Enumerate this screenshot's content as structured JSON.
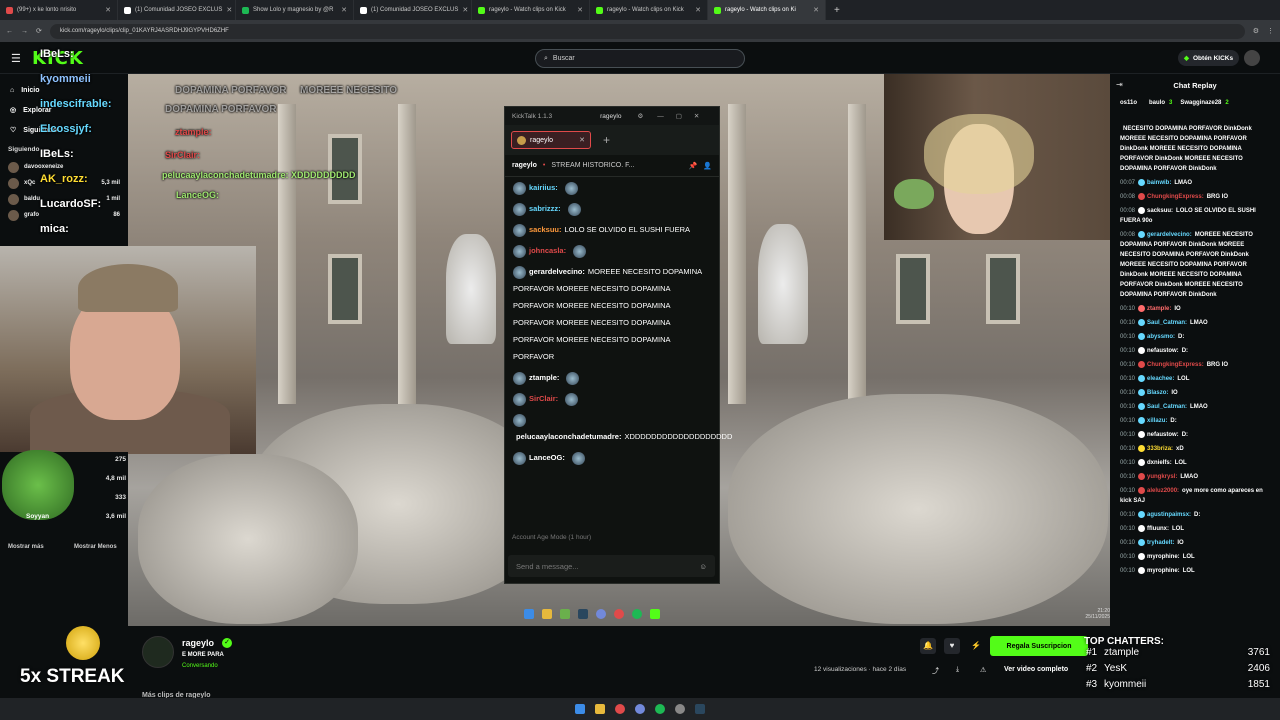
{
  "browser": {
    "tabs": [
      {
        "label": "(99+) x ke lonto nrisito",
        "active": false,
        "color": "#e04a4a"
      },
      {
        "label": "(1) Comunidad JOSEO EXCLUS",
        "active": false,
        "color": "#ffffff"
      },
      {
        "label": "Show Lolo y magnesio by @R",
        "active": false,
        "color": "#1db954"
      },
      {
        "label": "(1) Comunidad JOSEO EXCLUS",
        "active": false,
        "color": "#ffffff"
      },
      {
        "label": "rageylo - Watch clips on Kick",
        "active": false,
        "color": "#53fc18"
      },
      {
        "label": "rageylo - Watch clips on Kick",
        "active": false,
        "color": "#53fc18"
      },
      {
        "label": "rageylo - Watch clips on Ki",
        "active": true,
        "color": "#53fc18"
      }
    ],
    "url": "kick.com/rageylo/clips/clip_01KAYRJ4ASRDHJ9GYPVHD6ZHF"
  },
  "kick": {
    "logo": "KICK",
    "search_placeholder": "Buscar",
    "get_kicks": "Obtén KICKs",
    "nav": [
      "Inicio",
      "Explorar",
      "Siguiendo"
    ],
    "following_header": "Siguiendo",
    "following": [
      {
        "name": "davooxeneize",
        "count": ""
      },
      {
        "name": "xQc",
        "count": "5,3 mil"
      },
      {
        "name": "baldu",
        "count": "1 mil"
      },
      {
        "name": "grafo",
        "count": "86"
      },
      {
        "name": "",
        "count": "275"
      },
      {
        "name": "",
        "count": "4,8 mil"
      },
      {
        "name": "",
        "count": "333"
      },
      {
        "name": "Soyyan",
        "count": "3,6 mil"
      }
    ],
    "show_more": "Mostrar más",
    "show_less": "Mostrar Menos"
  },
  "overlay_chat": [
    {
      "user": "IBeLs:",
      "color": "#ffffff"
    },
    {
      "user": "kyommeii",
      "color": "#8ec2ff"
    },
    {
      "user": "indescifrable:",
      "color": "#66d9ff"
    },
    {
      "user": "Elcossjyf:",
      "color": "#66d9ff"
    },
    {
      "user": "IBeLs:",
      "color": "#ffffff"
    },
    {
      "user": "AK_rozz:",
      "color": "#ffdd33"
    },
    {
      "user": "LucardoSF:",
      "color": "#ffffff"
    },
    {
      "user": "mica:",
      "color": "#ffffff"
    }
  ],
  "overlay_texts": {
    "dopamina1": "DOPAMINA PORFAVOR",
    "dopamina2": "MOREEE NECESITO",
    "dopamina3": "DOPAMINA PORFAVOR",
    "ztample": "ztample:",
    "sirclair": "SirClair:",
    "pelu": "pelucaaylaconchadetumadre: XDDDDDDDDD",
    "lanceog": "LanceOG:"
  },
  "kicktalk": {
    "title": "KickTalk 1.1.3",
    "channel": "rageylo",
    "tab": "rageylo",
    "stream_title": "STREAM HISTORICO. F...",
    "messages": [
      {
        "user": "kairiius:",
        "color": "#66d9ff",
        "text": ""
      },
      {
        "user": "sabrizzz:",
        "color": "#66d9ff",
        "text": ""
      },
      {
        "user": "sacksuu:",
        "color": "#ff9a3c",
        "text": "LOLO SE OLVIDO EL SUSHI FUERA"
      },
      {
        "user": "johncasla:",
        "color": "#e04a4a",
        "text": ""
      },
      {
        "user": "gerardelvecino:",
        "color": "#ffffff",
        "text": "MOREEE NECESITO DOPAMINA PORFAVOR MOREEE NECESITO DOPAMINA PORFAVOR MOREEE NECESITO DOPAMINA PORFAVOR MOREEE NECESITO DOPAMINA PORFAVOR MOREEE NECESITO DOPAMINA PORFAVOR"
      },
      {
        "user": "ztample:",
        "color": "#ffffff",
        "text": ""
      },
      {
        "user": "SirClair:",
        "color": "#e04a4a",
        "text": ""
      },
      {
        "user": "pelucaaylaconchadetumadre:",
        "color": "#ffffff",
        "text": "XDDDDDDDDDDDDDDDDDDD"
      },
      {
        "user": "LanceOG:",
        "color": "#ffffff",
        "text": ""
      }
    ],
    "age_mode": "Account Age Mode (1 hour)",
    "input_placeholder": "Send a message..."
  },
  "chat_replay": {
    "title": "Chat Replay",
    "leaders": [
      {
        "name": "os11o",
        "n": ""
      },
      {
        "name": "baulo",
        "n": "3"
      },
      {
        "name": "Swagginaze28",
        "n": "2"
      }
    ],
    "messages": [
      {
        "time": "",
        "user": "",
        "color": "#ffffff",
        "text": "NECESITO DOPAMINA PORFAVOR DinkDonk MOREEE NECESITO DOPAMINA PORFAVOR DinkDonk MOREEE NECESITO DOPAMINA PORFAVOR DinkDonk MOREEE NECESITO DOPAMINA PORFAVOR DinkDonk"
      },
      {
        "time": "00:07",
        "user": "bainwib:",
        "color": "#66d9ff",
        "text": "LMAO"
      },
      {
        "time": "00:08",
        "user": "ChungkingExpress:",
        "color": "#e04a4a",
        "text": "BRG IO"
      },
      {
        "time": "00:08",
        "user": "sacksuu:",
        "color": "#ffffff",
        "text": "LOLO SE OLVIDO EL SUSHI FUERA 90o"
      },
      {
        "time": "00:08",
        "user": "gerardelvecino:",
        "color": "#66d9ff",
        "text": "MOREEE NECESITO DOPAMINA PORFAVOR DinkDonk MOREEE NECESITO DOPAMINA PORFAVOR DinkDonk MOREEE NECESITO DOPAMINA PORFAVOR DinkDonk MOREEE NECESITO DOPAMINA PORFAVOR DinkDonk MOREEE NECESITO DOPAMINA PORFAVOR DinkDonk"
      },
      {
        "time": "00:10",
        "user": "ztample:",
        "color": "#ff6b6b",
        "text": "IO"
      },
      {
        "time": "00:10",
        "user": "Saul_Catman:",
        "color": "#66d9ff",
        "text": "LMAO"
      },
      {
        "time": "00:10",
        "user": "abyssmo:",
        "color": "#66d9ff",
        "text": "D:"
      },
      {
        "time": "00:10",
        "user": "nefaustow:",
        "color": "#ffffff",
        "text": "D:"
      },
      {
        "time": "00:10",
        "user": "ChungkingExpress:",
        "color": "#e04a4a",
        "text": "BRG IO"
      },
      {
        "time": "00:10",
        "user": "eleachee:",
        "color": "#66d9ff",
        "text": "LOL"
      },
      {
        "time": "00:10",
        "user": "Blaszo:",
        "color": "#66d9ff",
        "text": "IO"
      },
      {
        "time": "00:10",
        "user": "Saul_Catman:",
        "color": "#66d9ff",
        "text": "LMAO"
      },
      {
        "time": "00:10",
        "user": "xillazu:",
        "color": "#66d9ff",
        "text": "D:"
      },
      {
        "time": "00:10",
        "user": "nefaustow:",
        "color": "#ffffff",
        "text": "D:"
      },
      {
        "time": "00:10",
        "user": "333briza:",
        "color": "#ffdd33",
        "text": "xD"
      },
      {
        "time": "00:10",
        "user": "dxnielfs:",
        "color": "#ffffff",
        "text": "LOL"
      },
      {
        "time": "00:10",
        "user": "yungkrysl:",
        "color": "#e04a4a",
        "text": "LMAO"
      },
      {
        "time": "00:10",
        "user": "aleluz2000:",
        "color": "#e04a4a",
        "text": "oye more como apareces en kick SAJ"
      },
      {
        "time": "00:10",
        "user": "agustinpaimsx:",
        "color": "#66d9ff",
        "text": "D:"
      },
      {
        "time": "00:10",
        "user": "ffluunx:",
        "color": "#ffffff",
        "text": "LOL"
      },
      {
        "time": "00:10",
        "user": "tryhadelt:",
        "color": "#66d9ff",
        "text": "IO"
      },
      {
        "time": "00:10",
        "user": "myrophine:",
        "color": "#ffffff",
        "text": "LOL"
      },
      {
        "time": "00:10",
        "user": "myrophine:",
        "color": "#ffffff",
        "text": "LOL"
      }
    ]
  },
  "channel": {
    "name": "rageylo",
    "subtitle": "E MORE PARA",
    "status": "Conversando",
    "views": "12 visualizaciones",
    "ago": "hace 2 días",
    "gift_button": "Regala Suscripcion",
    "full_video": "Ver video completo",
    "more_clips": "Más clips de rageylo"
  },
  "streak": "5x STREAK",
  "top_chatters": {
    "title": "TOP CHATTERS:",
    "rows": [
      {
        "rank": "#1",
        "name": "ztample",
        "score": "3761"
      },
      {
        "rank": "#2",
        "name": "YesK",
        "score": "2406"
      },
      {
        "rank": "#3",
        "name": "kyommeii",
        "score": "1851"
      }
    ]
  },
  "clock": {
    "time": "21:20",
    "date": "25/11/2025",
    "lang": "ESP LAA"
  },
  "colors": {
    "kick_green": "#53fc18",
    "bg": "#0b0e0f"
  }
}
